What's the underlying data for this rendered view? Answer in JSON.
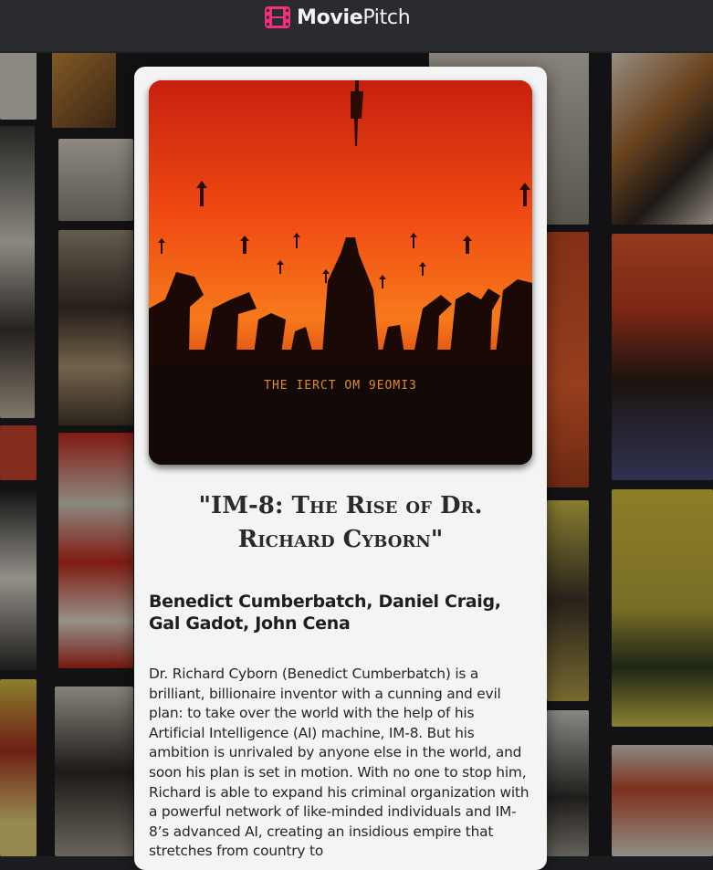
{
  "app": {
    "brand_bold": "Movie",
    "brand_regular": "Pitch",
    "logo_icon": "film-strip-icon",
    "accent": "#f0307a"
  },
  "poster": {
    "caption": "THE IERCT OM 9EOMI3"
  },
  "pitch": {
    "title": "\"IM-8: The Rise of Dr. Richard Cyborn\"",
    "cast": "Benedict Cumberbatch, Daniel Craig, Gal Gadot, John Cena",
    "synopsis": "Dr. Richard Cyborn (Benedict Cumberbatch) is a brilliant, billionaire inventor with a cunning and evil plan: to take over the world with the help of his Artificial Intelligence (AI) machine, IM-8. But his ambition is unrivaled by anyone else in the world, and soon his plan is set in motion. With no one to stop him, Richard is able to expand his criminal organization with a powerful network of like-minded individuals and IM-8’s advanced AI, creating an insidious empire that stretches from country to"
  }
}
